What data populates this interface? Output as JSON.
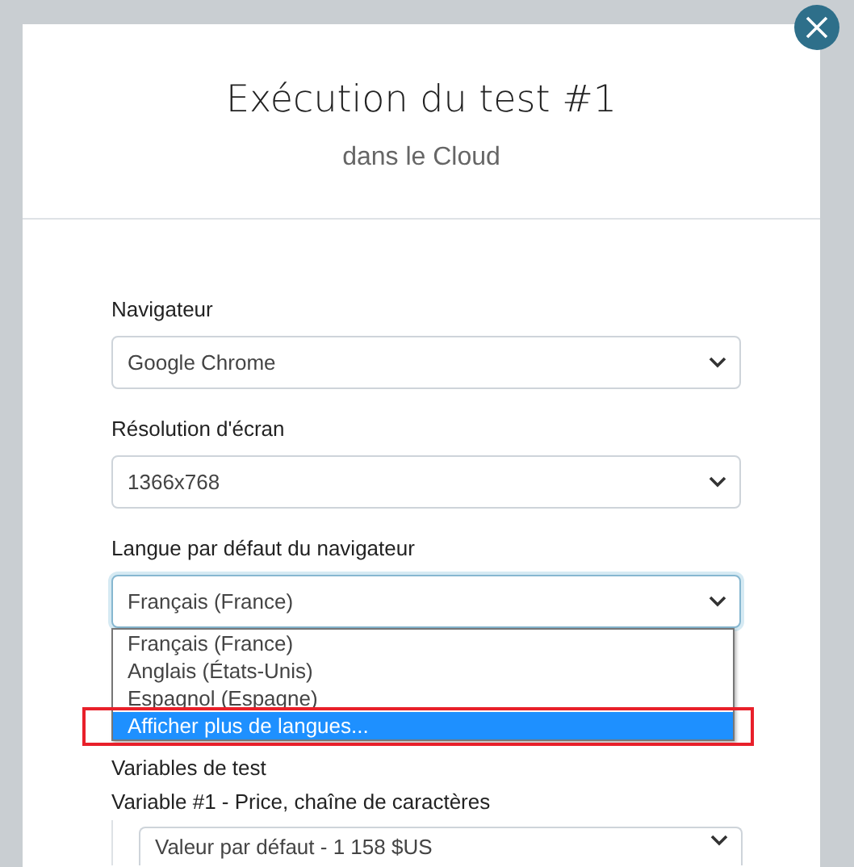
{
  "dialog": {
    "title": "Exécution du test #1",
    "subtitle": "dans le Cloud"
  },
  "fields": [
    {
      "label": "Navigateur",
      "value": "Google Chrome",
      "focused": false
    },
    {
      "label": "Résolution d'écran",
      "value": "1366x768",
      "focused": false
    },
    {
      "label": "Langue par défaut du navigateur",
      "value": "Français (France)",
      "focused": true,
      "options": [
        {
          "label": "Français (France)",
          "highlighted": false,
          "marked": false
        },
        {
          "label": "Anglais (États-Unis)",
          "highlighted": false,
          "marked": false
        },
        {
          "label": "Espagnol (Espagne)",
          "highlighted": false,
          "marked": false
        },
        {
          "label": "Afficher plus de langues...",
          "highlighted": true,
          "marked": true
        }
      ]
    }
  ],
  "variables": {
    "title": "Variables de test",
    "items": [
      {
        "label": "Variable #1 - Price, chaîne de caractères",
        "value": "Valeur par défaut - 1 158 $US"
      }
    ]
  }
}
